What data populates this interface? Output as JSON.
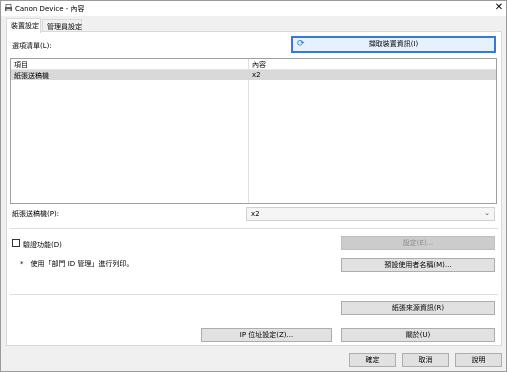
{
  "window": {
    "title": "Canon Device - 內容",
    "close": "✕"
  },
  "tabs": [
    {
      "label": "裝置設定"
    },
    {
      "label": "管理員設定"
    }
  ],
  "options_list": {
    "label": "選項清單(L):",
    "get_info_button": "擷取裝置資訊(I)",
    "columns": [
      "項目",
      "內容"
    ],
    "rows": [
      {
        "item": "紙張送稿機",
        "content": "x2"
      }
    ]
  },
  "paper_feeder": {
    "label": "紙張送稿機(P):",
    "value": "x2"
  },
  "auth": {
    "checkbox_label": "驗證功能(D)",
    "note": "*　使用「部門 ID 管理」進行列印。",
    "settings_button": "設定(E)...",
    "default_user_button": "預設使用者名稱(M)..."
  },
  "paper_source_button": "紙張來源資訊(R)",
  "ip_button": "IP 位址設定(Z)...",
  "about_button": "關於(U)",
  "dialog_buttons": {
    "ok": "確定",
    "cancel": "取消",
    "help": "說明"
  }
}
